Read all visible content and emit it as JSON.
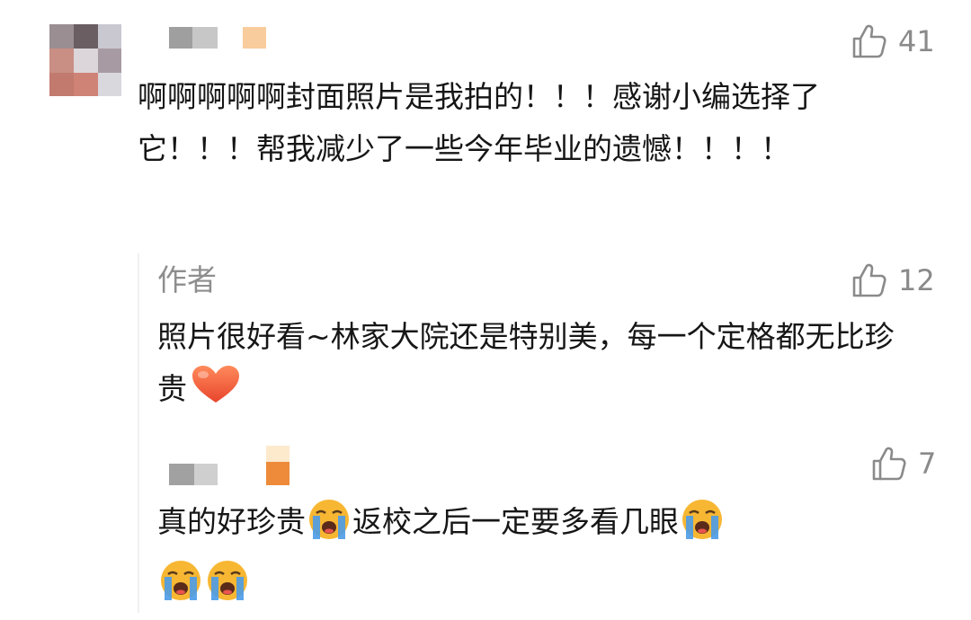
{
  "comments": [
    {
      "likes": "41",
      "text": "啊啊啊啊啊封面照片是我拍的！！！感谢小编选择了它！！！帮我减少了一些今年毕业的遗憾！！！！"
    }
  ],
  "replies": [
    {
      "author": "作者",
      "likes": "12",
      "text": "照片很好看~林家大院还是特别美，每一个定格都无比珍贵",
      "trailing_emoji": "heart-icon"
    },
    {
      "likes": "7",
      "text_part1": "真的好珍贵",
      "text_part2": "返校之后一定要多看几眼",
      "emoji": "loudly-crying-face-icon"
    }
  ],
  "colors": {
    "text": "#161616",
    "muted": "#8e8e8e",
    "like_icon": "#8a8a8a",
    "heart": "#f26a3a",
    "emoji_face": "#f7b733"
  }
}
